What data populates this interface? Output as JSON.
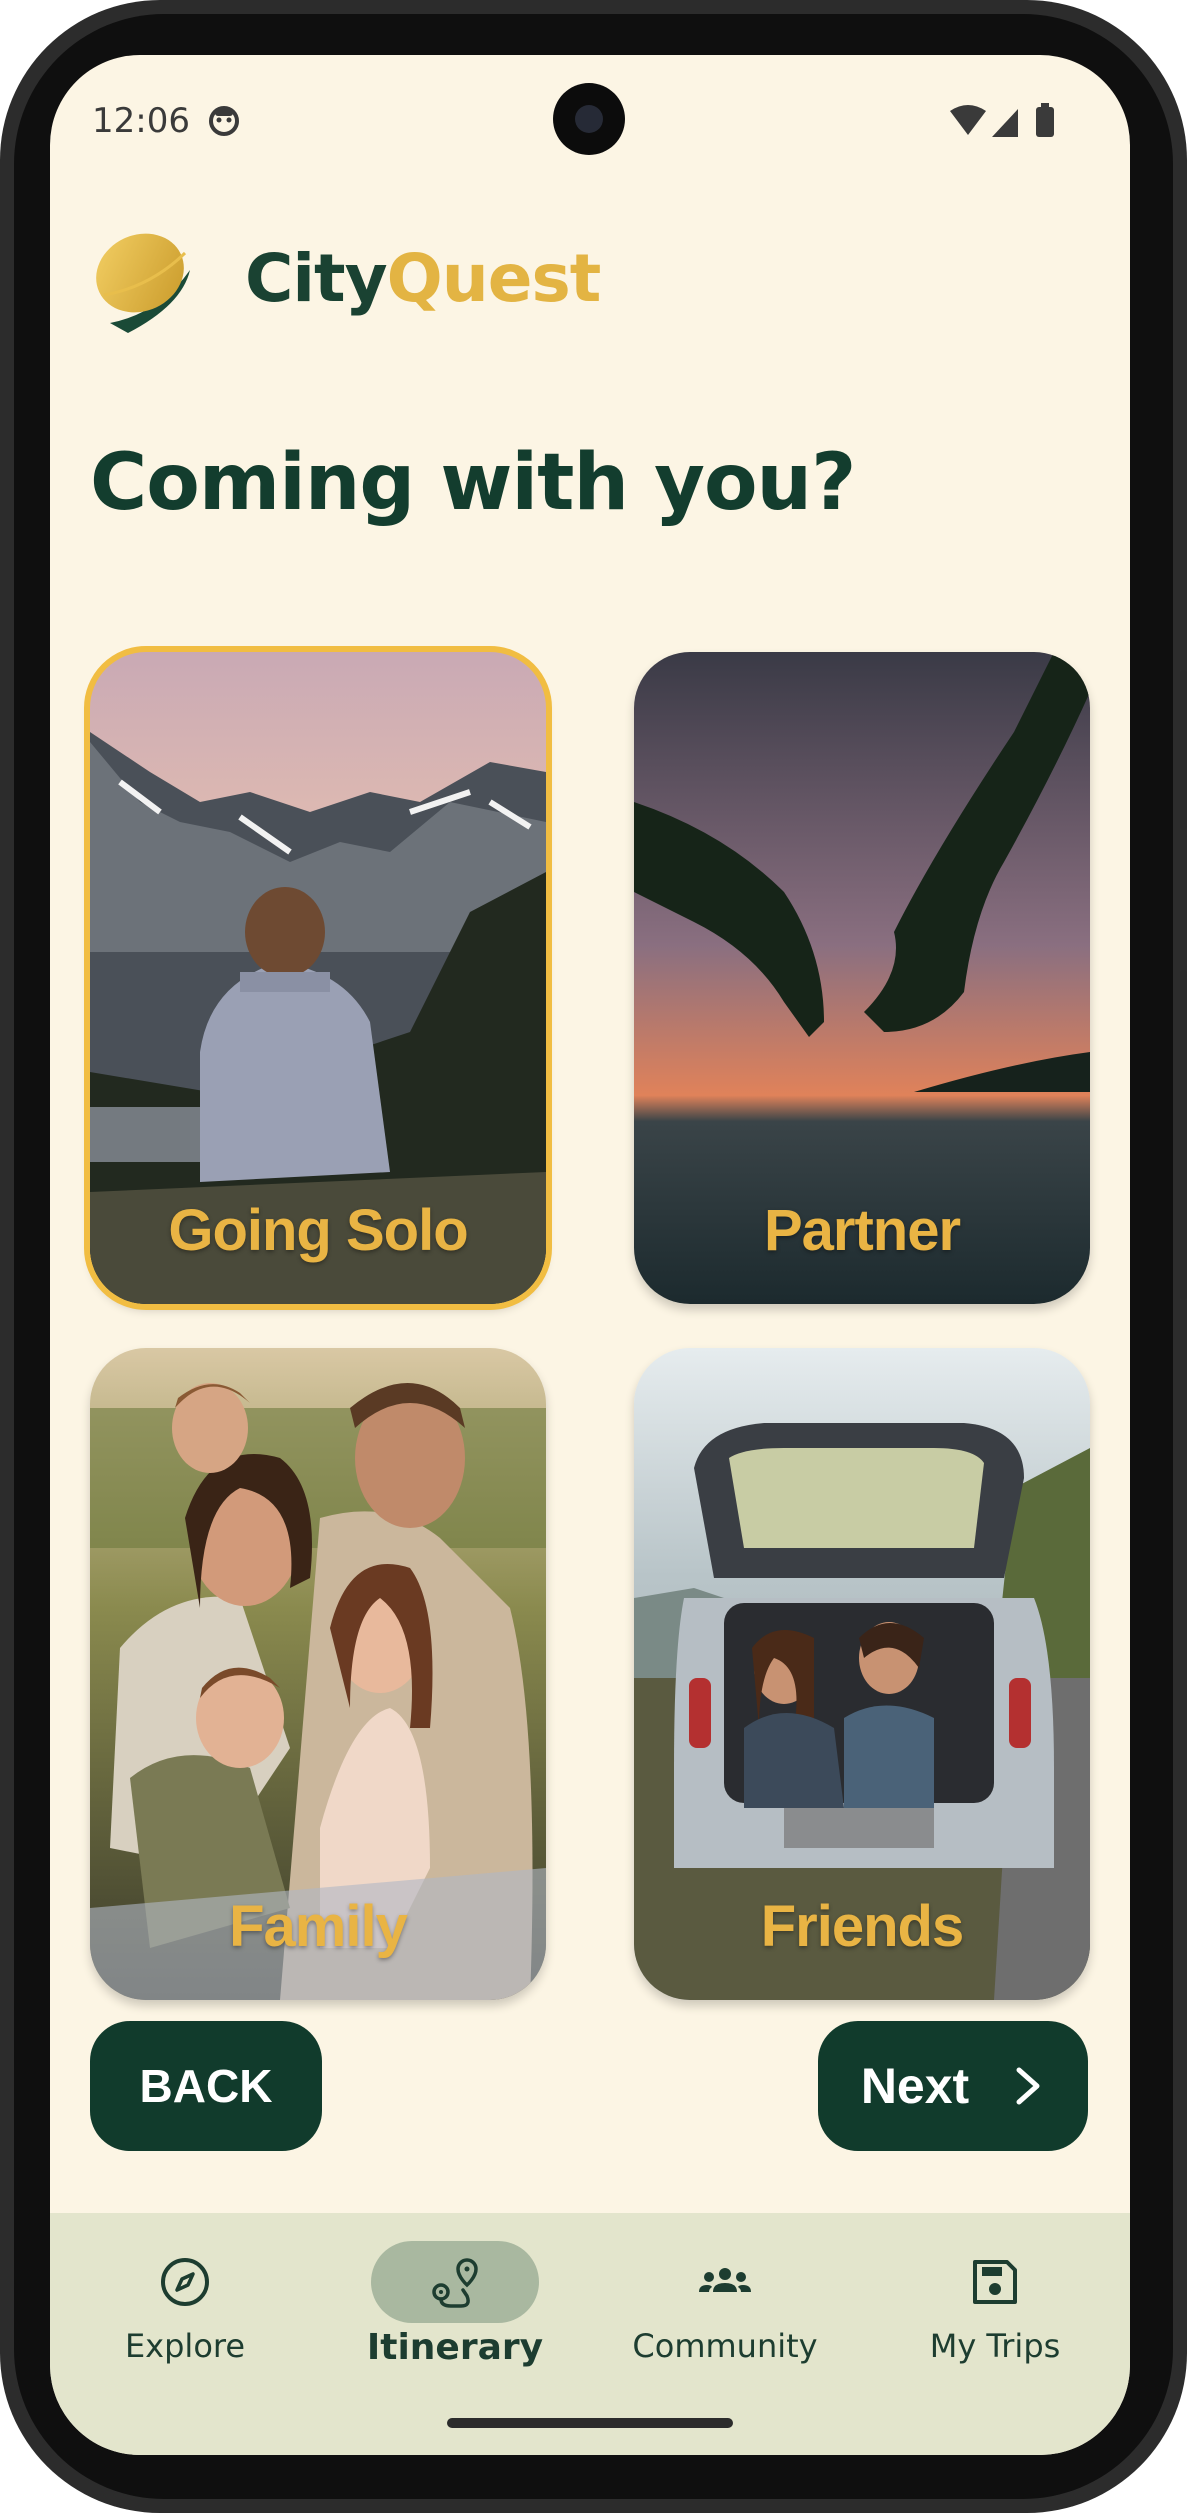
{
  "status_bar": {
    "time": "12:06"
  },
  "brand": {
    "part1": "City",
    "part2": "Quest"
  },
  "page": {
    "title": "Coming with you?"
  },
  "options": [
    {
      "label": "Going Solo",
      "selected": true
    },
    {
      "label": "Partner",
      "selected": false
    },
    {
      "label": "Family",
      "selected": false
    },
    {
      "label": "Friends",
      "selected": false
    }
  ],
  "actions": {
    "back_label": "BACK",
    "next_label": "Next"
  },
  "nav": {
    "items": [
      {
        "label": "Explore",
        "icon": "compass-icon",
        "active": false
      },
      {
        "label": "Itinerary",
        "icon": "route-icon",
        "active": true
      },
      {
        "label": "Community",
        "icon": "group-icon",
        "active": false
      },
      {
        "label": "My Trips",
        "icon": "save-icon",
        "active": false
      }
    ]
  },
  "colors": {
    "background": "#fcf5e4",
    "primary": "#113b2c",
    "accent": "#e9b444",
    "nav_background": "#e3e5cc",
    "nav_active_pill": "#a9b8a0"
  }
}
